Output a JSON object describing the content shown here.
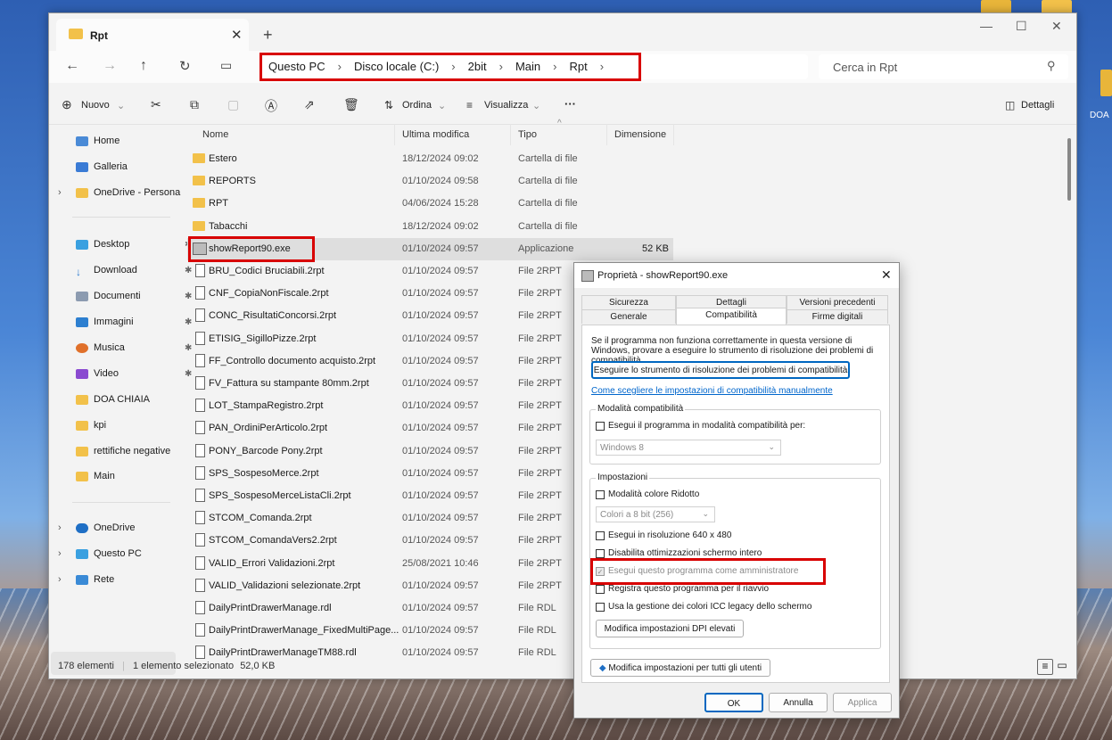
{
  "desktop": {
    "label_right": "DOA"
  },
  "explorer": {
    "tab_title": "Rpt",
    "breadcrumb": [
      "Questo PC",
      "Disco locale (C:)",
      "2bit",
      "Main",
      "Rpt"
    ],
    "search_placeholder": "Cerca in Rpt",
    "toolbar": {
      "new": "Nuovo",
      "sort": "Ordina",
      "view": "Visualizza",
      "more": "···",
      "details": "Dettagli"
    },
    "sidebar": {
      "home": "Home",
      "gallery": "Galleria",
      "onedrive_personal": "OneDrive - Persona",
      "desktop": "Desktop",
      "download": "Download",
      "documents": "Documenti",
      "images": "Immagini",
      "music": "Musica",
      "video": "Video",
      "doa": "DOA CHIAIA",
      "kpi": "kpi",
      "rettifiche": "rettifiche negative",
      "main": "Main",
      "onedrive": "OneDrive",
      "this_pc": "Questo PC",
      "network": "Rete"
    },
    "columns": {
      "name": "Nome",
      "modified": "Ultima modifica",
      "type": "Tipo",
      "size": "Dimensione"
    },
    "files": [
      {
        "name": "Estero",
        "date": "18/12/2024 09:02",
        "type": "Cartella di file",
        "size": "",
        "kind": "folder"
      },
      {
        "name": "REPORTS",
        "date": "01/10/2024 09:58",
        "type": "Cartella di file",
        "size": "",
        "kind": "folder"
      },
      {
        "name": "RPT",
        "date": "04/06/2024 15:28",
        "type": "Cartella di file",
        "size": "",
        "kind": "folder"
      },
      {
        "name": "Tabacchi",
        "date": "18/12/2024 09:02",
        "type": "Cartella di file",
        "size": "",
        "kind": "folder"
      },
      {
        "name": "showReport90.exe",
        "date": "01/10/2024 09:57",
        "type": "Applicazione",
        "size": "52 KB",
        "kind": "exe"
      },
      {
        "name": "BRU_Codici Bruciabili.2rpt",
        "date": "01/10/2024 09:57",
        "type": "File 2RPT",
        "size": "",
        "kind": "doc"
      },
      {
        "name": "CNF_CopiaNonFiscale.2rpt",
        "date": "01/10/2024 09:57",
        "type": "File 2RPT",
        "size": "",
        "kind": "doc"
      },
      {
        "name": "CONC_RisultatiConcorsi.2rpt",
        "date": "01/10/2024 09:57",
        "type": "File 2RPT",
        "size": "",
        "kind": "doc"
      },
      {
        "name": "ETISIG_SigilloPizze.2rpt",
        "date": "01/10/2024 09:57",
        "type": "File 2RPT",
        "size": "",
        "kind": "doc"
      },
      {
        "name": "FF_Controllo documento acquisto.2rpt",
        "date": "01/10/2024 09:57",
        "type": "File 2RPT",
        "size": "",
        "kind": "doc"
      },
      {
        "name": "FV_Fattura su stampante 80mm.2rpt",
        "date": "01/10/2024 09:57",
        "type": "File 2RPT",
        "size": "",
        "kind": "doc"
      },
      {
        "name": "LOT_StampaRegistro.2rpt",
        "date": "01/10/2024 09:57",
        "type": "File 2RPT",
        "size": "",
        "kind": "doc"
      },
      {
        "name": "PAN_OrdiniPerArticolo.2rpt",
        "date": "01/10/2024 09:57",
        "type": "File 2RPT",
        "size": "",
        "kind": "doc"
      },
      {
        "name": "PONY_Barcode Pony.2rpt",
        "date": "01/10/2024 09:57",
        "type": "File 2RPT",
        "size": "",
        "kind": "doc"
      },
      {
        "name": "SPS_SospesoMerce.2rpt",
        "date": "01/10/2024 09:57",
        "type": "File 2RPT",
        "size": "",
        "kind": "doc"
      },
      {
        "name": "SPS_SospesoMerceListaCli.2rpt",
        "date": "01/10/2024 09:57",
        "type": "File 2RPT",
        "size": "",
        "kind": "doc"
      },
      {
        "name": "STCOM_Comanda.2rpt",
        "date": "01/10/2024 09:57",
        "type": "File 2RPT",
        "size": "",
        "kind": "doc"
      },
      {
        "name": "STCOM_ComandaVers2.2rpt",
        "date": "01/10/2024 09:57",
        "type": "File 2RPT",
        "size": "",
        "kind": "doc"
      },
      {
        "name": "VALID_Errori Validazioni.2rpt",
        "date": "25/08/2021 10:46",
        "type": "File 2RPT",
        "size": "",
        "kind": "doc"
      },
      {
        "name": "VALID_Validazioni selezionate.2rpt",
        "date": "01/10/2024 09:57",
        "type": "File 2RPT",
        "size": "",
        "kind": "doc"
      },
      {
        "name": "DailyPrintDrawerManage.rdl",
        "date": "01/10/2024 09:57",
        "type": "File RDL",
        "size": "",
        "kind": "doc"
      },
      {
        "name": "DailyPrintDrawerManage_FixedMultiPage...",
        "date": "01/10/2024 09:57",
        "type": "File RDL",
        "size": "",
        "kind": "doc"
      },
      {
        "name": "DailyPrintDrawerManageTM88.rdl",
        "date": "01/10/2024 09:57",
        "type": "File RDL",
        "size": "",
        "kind": "doc"
      }
    ],
    "status": {
      "count": "178 elementi",
      "selected": "1 elemento selezionato",
      "size": "52,0 KB"
    }
  },
  "dialog": {
    "title": "Proprietà - showReport90.exe",
    "tabs_top": [
      "Sicurezza",
      "Dettagli",
      "Versioni precedenti"
    ],
    "tabs_bottom": [
      "Generale",
      "Compatibilità",
      "Firme digitali"
    ],
    "intro": "Se il programma non funziona correttamente in questa versione di Windows, provare a eseguire lo strumento di risoluzione dei problemi di compatibilità.",
    "troubleshoot_button": "Eseguire lo strumento di risoluzione dei problemi di compatibilità",
    "manual_link": "Come scegliere le impostazioni di compatibilità manualmente",
    "compat_group": "Modalità compatibilità",
    "compat_check": "Esegui il programma in modalità compatibilità per:",
    "compat_os": "Windows 8",
    "settings_group": "Impostazioni",
    "reduced_color": "Modalità colore Ridotto",
    "color_option": "Colori a 8 bit (256)",
    "res640": "Esegui in risoluzione 640 x 480",
    "disable_fullscreen": "Disabilita ottimizzazioni schermo intero",
    "run_admin": "Esegui questo programma come amministratore",
    "register_restart": "Registra questo programma per il riavvio",
    "icc_legacy": "Usa la gestione dei colori ICC legacy dello schermo",
    "dpi_button": "Modifica impostazioni DPI elevati",
    "all_users_button": "Modifica impostazioni per tutti gli utenti",
    "ok": "OK",
    "cancel": "Annulla",
    "apply": "Applica"
  }
}
